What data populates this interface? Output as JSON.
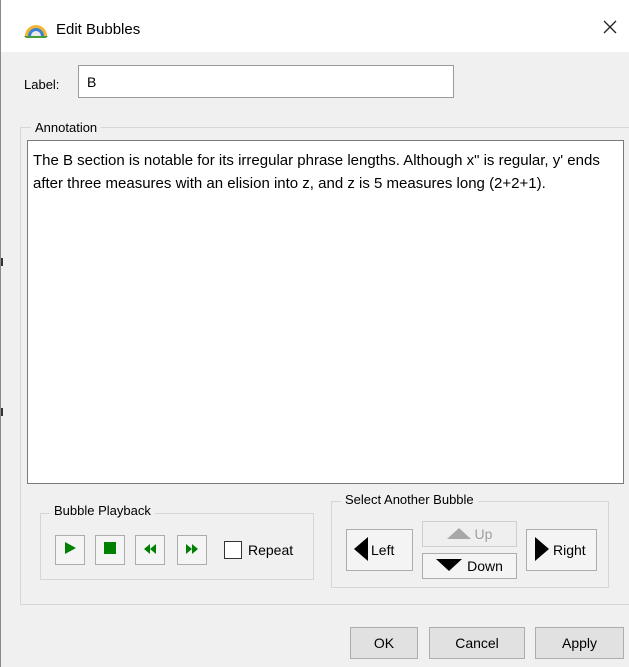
{
  "window": {
    "title": "Edit Bubbles",
    "title_icon": "rainbow-bubble-icon",
    "close_icon": "close-icon"
  },
  "label_field": {
    "caption": "Label:",
    "value": "B"
  },
  "annotation": {
    "legend": "Annotation",
    "text": "The B section is notable for its irregular phrase lengths. Although x\" is regular, y' ends after three measures with an elision into z, and z is 5 measures long (2+2+1)."
  },
  "bubble_playback": {
    "legend": "Bubble Playback",
    "buttons": [
      {
        "icon": "play-icon"
      },
      {
        "icon": "stop-icon"
      },
      {
        "icon": "rewind-icon"
      },
      {
        "icon": "fast-forward-icon"
      }
    ],
    "repeat_label": "Repeat",
    "repeat_checked": false
  },
  "select_bubble": {
    "legend": "Select Another Bubble",
    "left_label": "Left",
    "up_label": "Up",
    "down_label": "Down",
    "right_label": "Right",
    "up_enabled": false
  },
  "dialog_buttons": {
    "ok": "OK",
    "cancel": "Cancel",
    "apply": "Apply"
  },
  "colors": {
    "playback_icon": "#008000",
    "dialog_bg": "#f0f0f0",
    "title_bg": "#ffffff"
  }
}
